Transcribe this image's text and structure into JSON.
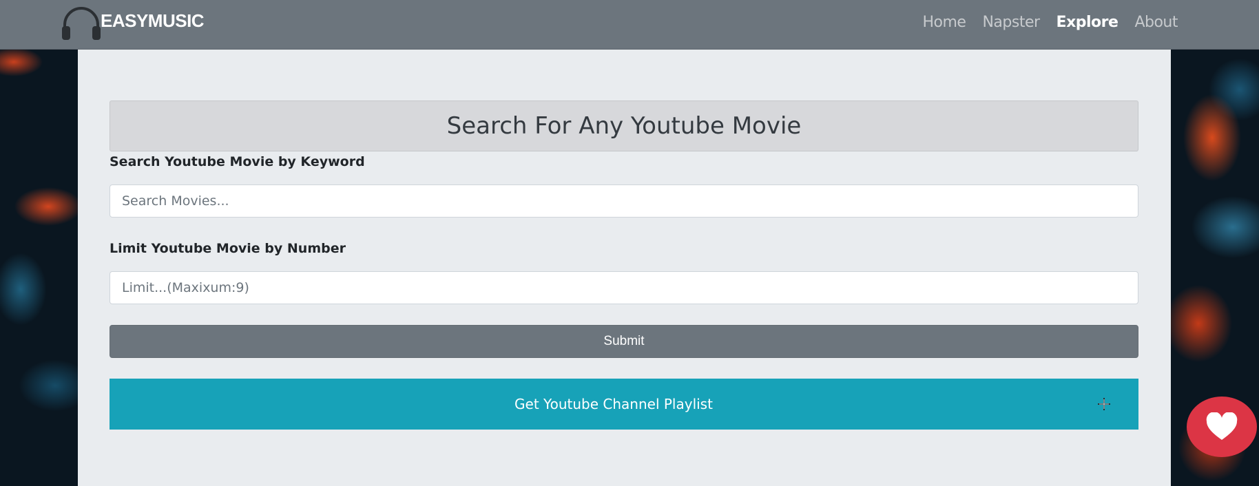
{
  "navbar": {
    "brand": "EASYMUSIC",
    "brand_icon": "headphones-icon",
    "links": [
      {
        "label": "Home",
        "active": false
      },
      {
        "label": "Napster",
        "active": false
      },
      {
        "label": "Explore",
        "active": true
      },
      {
        "label": "About",
        "active": false
      }
    ]
  },
  "main": {
    "title": "Search For Any Youtube Movie",
    "keyword_label": "Search Youtube Movie by Keyword",
    "keyword_placeholder": "Search Movies...",
    "limit_label": "Limit Youtube Movie by Number",
    "limit_placeholder": "Limit...(Maxixum:9)",
    "submit_label": "Submit",
    "playlist_label": "Get Youtube Channel Playlist",
    "playlist_icon": "plus-icon"
  },
  "fab": {
    "icon": "heart-icon"
  },
  "colors": {
    "navbar": "#6c757d",
    "panel": "#e9ecef",
    "accordion": "#17a2b8",
    "fab": "#dc3545"
  }
}
